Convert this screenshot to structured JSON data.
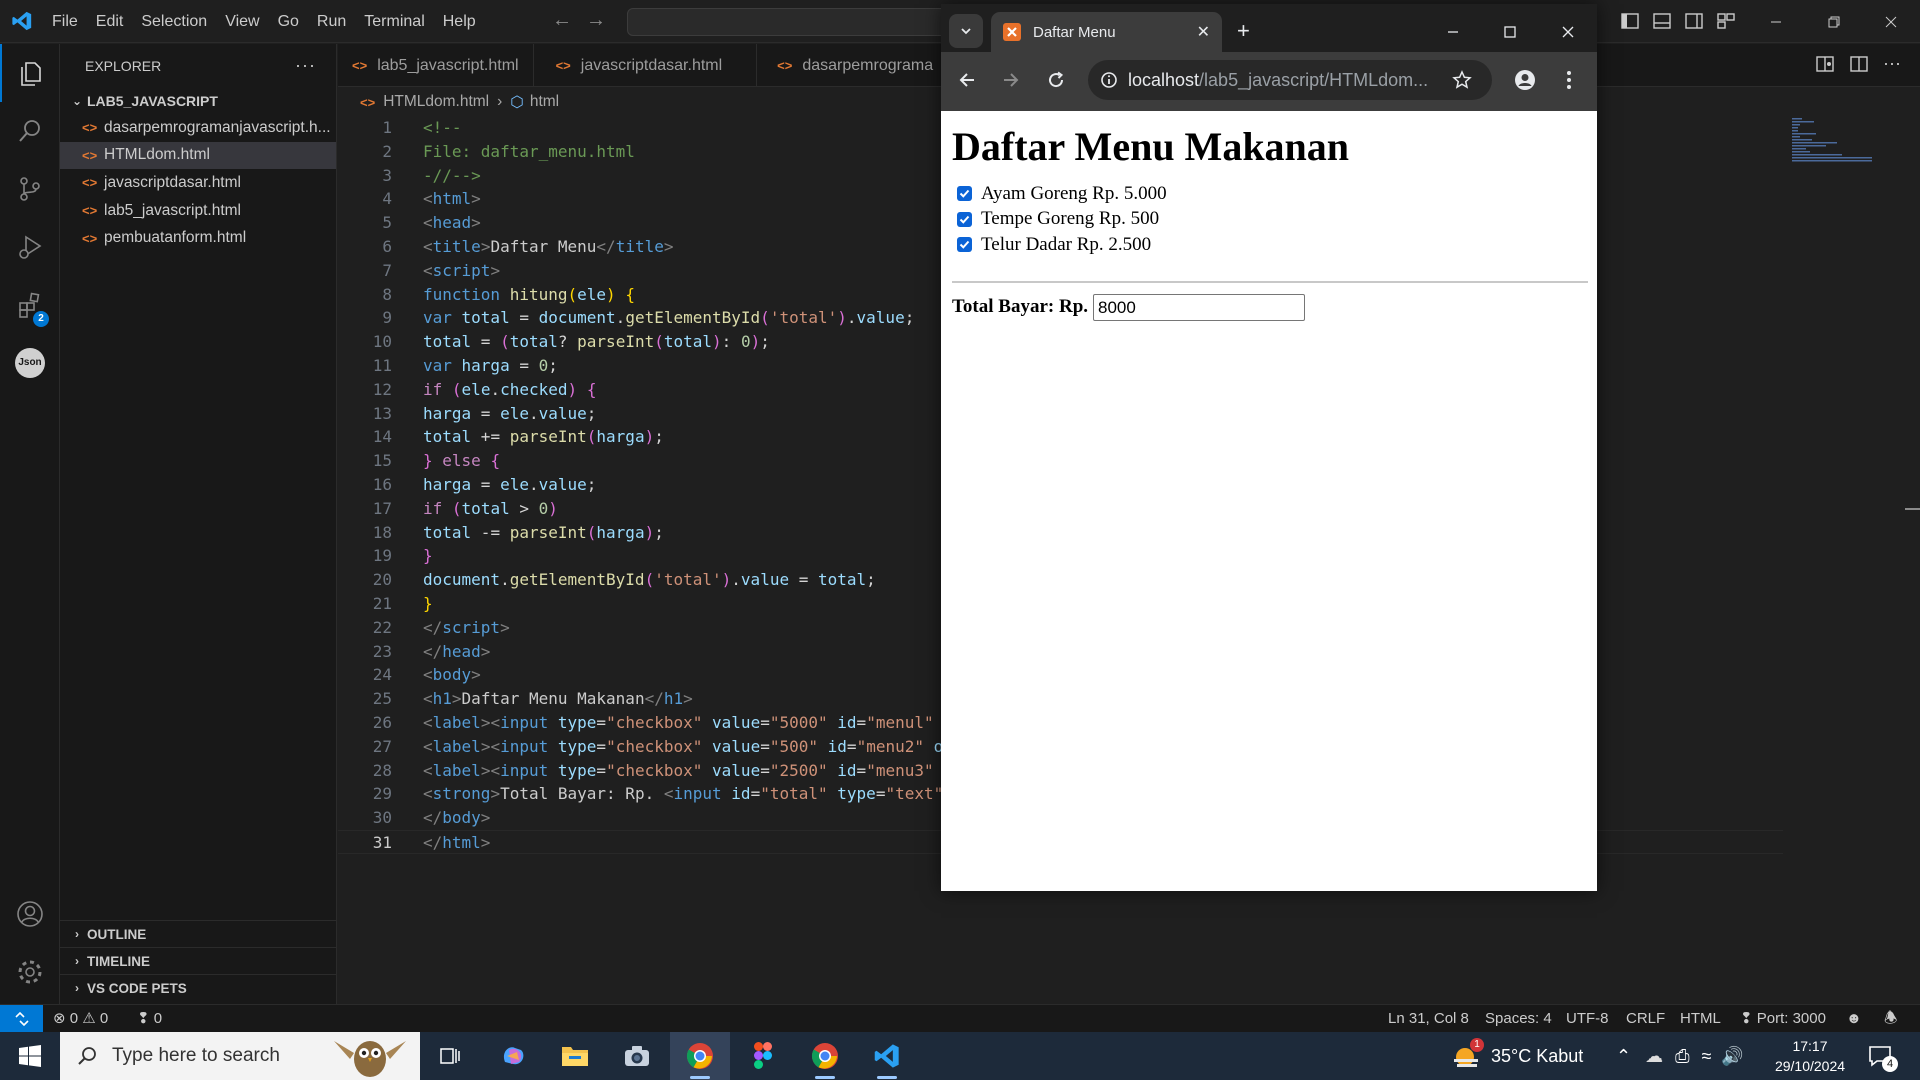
{
  "vscode": {
    "menu": [
      "File",
      "Edit",
      "Selection",
      "View",
      "Go",
      "Run",
      "Terminal",
      "Help"
    ],
    "explorer_title": "EXPLORER",
    "folder_name": "LAB5_JAVASCRIPT",
    "files": [
      {
        "name": "dasarpemrogramanjavascript.h...",
        "selected": false
      },
      {
        "name": "HTMLdom.html",
        "selected": true
      },
      {
        "name": "javascriptdasar.html",
        "selected": false
      },
      {
        "name": "lab5_javascript.html",
        "selected": false
      },
      {
        "name": "pembuatanform.html",
        "selected": false
      }
    ],
    "sections": [
      "OUTLINE",
      "TIMELINE",
      "VS CODE PETS"
    ],
    "extensions_badge": "2",
    "json_icon_label": "Json",
    "tabs": [
      "lab5_javascript.html",
      "javascriptdasar.html",
      "dasarpemrograma"
    ],
    "breadcrumb": {
      "file": "HTMLdom.html",
      "symbol": "html"
    },
    "current_line": 31,
    "code_lines": [
      [
        [
          "c-com",
          "<!--"
        ]
      ],
      [
        [
          "c-com",
          "File: daftar_menu.html"
        ]
      ],
      [
        [
          "c-com",
          "-//-->"
        ]
      ],
      [
        [
          "c-bra",
          "<"
        ],
        [
          "c-tag",
          "html"
        ],
        [
          "c-bra",
          ">"
        ]
      ],
      [
        [
          "c-bra",
          "<"
        ],
        [
          "c-tag",
          "head"
        ],
        [
          "c-bra",
          ">"
        ]
      ],
      [
        [
          "c-bra",
          "<"
        ],
        [
          "c-tag",
          "title"
        ],
        [
          "c-bra",
          ">"
        ],
        [
          "c-txt",
          "Daftar Menu"
        ],
        [
          "c-bra",
          "</"
        ],
        [
          "c-tag",
          "title"
        ],
        [
          "c-bra",
          ">"
        ]
      ],
      [
        [
          "c-bra",
          "<"
        ],
        [
          "c-tag",
          "script"
        ],
        [
          "c-bra",
          ">"
        ]
      ],
      [
        [
          "c-kw",
          "function "
        ],
        [
          "c-fn",
          "hitung"
        ],
        [
          "c-p1",
          "("
        ],
        [
          "c-var",
          "ele"
        ],
        [
          "c-p1",
          ")"
        ],
        [
          "c-pun",
          " "
        ],
        [
          "c-p1",
          "{"
        ]
      ],
      [
        [
          "c-kw",
          "var "
        ],
        [
          "c-var",
          "total"
        ],
        [
          "c-pun",
          " = "
        ],
        [
          "c-var",
          "document"
        ],
        [
          "c-pun",
          "."
        ],
        [
          "c-fn",
          "getElementById"
        ],
        [
          "c-p2",
          "("
        ],
        [
          "c-str",
          "'total'"
        ],
        [
          "c-p2",
          ")"
        ],
        [
          "c-pun",
          "."
        ],
        [
          "c-var",
          "value"
        ],
        [
          "c-pun",
          ";"
        ]
      ],
      [
        [
          "c-var",
          "total"
        ],
        [
          "c-pun",
          " = "
        ],
        [
          "c-p2",
          "("
        ],
        [
          "c-var",
          "total"
        ],
        [
          "c-pun",
          "? "
        ],
        [
          "c-fn",
          "parseInt"
        ],
        [
          "c-p2",
          "("
        ],
        [
          "c-var",
          "total"
        ],
        [
          "c-p2",
          ")"
        ],
        [
          "c-pun",
          ": "
        ],
        [
          "c-num",
          "0"
        ],
        [
          "c-p2",
          ")"
        ],
        [
          "c-pun",
          ";"
        ]
      ],
      [
        [
          "c-kw",
          "var "
        ],
        [
          "c-var",
          "harga"
        ],
        [
          "c-pun",
          " = "
        ],
        [
          "c-num",
          "0"
        ],
        [
          "c-pun",
          ";"
        ]
      ],
      [
        [
          "c-ctl",
          "if "
        ],
        [
          "c-p2",
          "("
        ],
        [
          "c-var",
          "ele"
        ],
        [
          "c-pun",
          "."
        ],
        [
          "c-var",
          "checked"
        ],
        [
          "c-p2",
          ")"
        ],
        [
          "c-pun",
          " "
        ],
        [
          "c-p2",
          "{"
        ]
      ],
      [
        [
          "c-var",
          "harga"
        ],
        [
          "c-pun",
          " = "
        ],
        [
          "c-var",
          "ele"
        ],
        [
          "c-pun",
          "."
        ],
        [
          "c-var",
          "value"
        ],
        [
          "c-pun",
          ";"
        ]
      ],
      [
        [
          "c-var",
          "total"
        ],
        [
          "c-pun",
          " += "
        ],
        [
          "c-fn",
          "parseInt"
        ],
        [
          "c-p2",
          "("
        ],
        [
          "c-var",
          "harga"
        ],
        [
          "c-p2",
          ")"
        ],
        [
          "c-pun",
          ";"
        ]
      ],
      [
        [
          "c-p2",
          "}"
        ],
        [
          "c-pun",
          " "
        ],
        [
          "c-ctl",
          "else"
        ],
        [
          "c-pun",
          " "
        ],
        [
          "c-p2",
          "{"
        ]
      ],
      [
        [
          "c-var",
          "harga"
        ],
        [
          "c-pun",
          " = "
        ],
        [
          "c-var",
          "ele"
        ],
        [
          "c-pun",
          "."
        ],
        [
          "c-var",
          "value"
        ],
        [
          "c-pun",
          ";"
        ]
      ],
      [
        [
          "c-ctl",
          "if "
        ],
        [
          "c-p2",
          "("
        ],
        [
          "c-var",
          "total"
        ],
        [
          "c-pun",
          " > "
        ],
        [
          "c-num",
          "0"
        ],
        [
          "c-p2",
          ")"
        ]
      ],
      [
        [
          "c-var",
          "total"
        ],
        [
          "c-pun",
          " -= "
        ],
        [
          "c-fn",
          "parseInt"
        ],
        [
          "c-p2",
          "("
        ],
        [
          "c-var",
          "harga"
        ],
        [
          "c-p2",
          ")"
        ],
        [
          "c-pun",
          ";"
        ]
      ],
      [
        [
          "c-p2",
          "}"
        ]
      ],
      [
        [
          "c-var",
          "document"
        ],
        [
          "c-pun",
          "."
        ],
        [
          "c-fn",
          "getElementById"
        ],
        [
          "c-p2",
          "("
        ],
        [
          "c-str",
          "'total'"
        ],
        [
          "c-p2",
          ")"
        ],
        [
          "c-pun",
          "."
        ],
        [
          "c-var",
          "value"
        ],
        [
          "c-pun",
          " = "
        ],
        [
          "c-var",
          "total"
        ],
        [
          "c-pun",
          ";"
        ]
      ],
      [
        [
          "c-p1",
          "}"
        ]
      ],
      [
        [
          "c-bra",
          "</"
        ],
        [
          "c-tag",
          "script"
        ],
        [
          "c-bra",
          ">"
        ]
      ],
      [
        [
          "c-bra",
          "</"
        ],
        [
          "c-tag",
          "head"
        ],
        [
          "c-bra",
          ">"
        ]
      ],
      [
        [
          "c-bra",
          "<"
        ],
        [
          "c-tag",
          "body"
        ],
        [
          "c-bra",
          ">"
        ]
      ],
      [
        [
          "c-bra",
          "<"
        ],
        [
          "c-tag",
          "h1"
        ],
        [
          "c-bra",
          ">"
        ],
        [
          "c-txt",
          "Daftar Menu Makanan"
        ],
        [
          "c-bra",
          "</"
        ],
        [
          "c-tag",
          "h1"
        ],
        [
          "c-bra",
          ">"
        ]
      ],
      [
        [
          "c-bra",
          "<"
        ],
        [
          "c-tag",
          "label"
        ],
        [
          "c-bra",
          "><"
        ],
        [
          "c-tag",
          "input"
        ],
        [
          "c-pun",
          " "
        ],
        [
          "c-var",
          "type"
        ],
        [
          "c-pun",
          "="
        ],
        [
          "c-str",
          "\"checkbox\""
        ],
        [
          "c-pun",
          " "
        ],
        [
          "c-var",
          "value"
        ],
        [
          "c-pun",
          "="
        ],
        [
          "c-str",
          "\"5000\""
        ],
        [
          "c-pun",
          " "
        ],
        [
          "c-var",
          "id"
        ],
        [
          "c-pun",
          "="
        ],
        [
          "c-str",
          "\"menul\""
        ]
      ],
      [
        [
          "c-bra",
          "<"
        ],
        [
          "c-tag",
          "label"
        ],
        [
          "c-bra",
          "><"
        ],
        [
          "c-tag",
          "input"
        ],
        [
          "c-pun",
          " "
        ],
        [
          "c-var",
          "type"
        ],
        [
          "c-pun",
          "="
        ],
        [
          "c-str",
          "\"checkbox\""
        ],
        [
          "c-pun",
          " "
        ],
        [
          "c-var",
          "value"
        ],
        [
          "c-pun",
          "="
        ],
        [
          "c-str",
          "\"500\""
        ],
        [
          "c-pun",
          " "
        ],
        [
          "c-var",
          "id"
        ],
        [
          "c-pun",
          "="
        ],
        [
          "c-str",
          "\"menu2\""
        ],
        [
          "c-pun",
          " "
        ],
        [
          "c-var",
          "o"
        ]
      ],
      [
        [
          "c-bra",
          "<"
        ],
        [
          "c-tag",
          "label"
        ],
        [
          "c-bra",
          "><"
        ],
        [
          "c-tag",
          "input"
        ],
        [
          "c-pun",
          " "
        ],
        [
          "c-var",
          "type"
        ],
        [
          "c-pun",
          "="
        ],
        [
          "c-str",
          "\"checkbox\""
        ],
        [
          "c-pun",
          " "
        ],
        [
          "c-var",
          "value"
        ],
        [
          "c-pun",
          "="
        ],
        [
          "c-str",
          "\"2500\""
        ],
        [
          "c-pun",
          " "
        ],
        [
          "c-var",
          "id"
        ],
        [
          "c-pun",
          "="
        ],
        [
          "c-str",
          "\"menu3\""
        ]
      ],
      [
        [
          "c-bra",
          "<"
        ],
        [
          "c-tag",
          "strong"
        ],
        [
          "c-bra",
          ">"
        ],
        [
          "c-txt",
          "Total Bayar: Rp. "
        ],
        [
          "c-bra",
          "<"
        ],
        [
          "c-tag",
          "input"
        ],
        [
          "c-pun",
          " "
        ],
        [
          "c-var",
          "id"
        ],
        [
          "c-pun",
          "="
        ],
        [
          "c-str",
          "\"total\""
        ],
        [
          "c-pun",
          " "
        ],
        [
          "c-var",
          "type"
        ],
        [
          "c-pun",
          "="
        ],
        [
          "c-str",
          "\"text\""
        ]
      ],
      [
        [
          "c-bra",
          "</"
        ],
        [
          "c-tag",
          "body"
        ],
        [
          "c-bra",
          ">"
        ]
      ],
      [
        [
          "c-bra",
          "</"
        ],
        [
          "c-tag",
          "html"
        ],
        [
          "c-bra",
          ">"
        ]
      ]
    ],
    "status": {
      "errors": "0",
      "warnings": "0",
      "ports": "0",
      "position": "Ln 31, Col 8",
      "spaces": "Spaces: 4",
      "encoding": "UTF-8",
      "eol": "CRLF",
      "language": "HTML",
      "port": "Port: 3000"
    }
  },
  "chrome": {
    "tab_title": "Daftar Menu",
    "url_host": "localhost",
    "url_path": "/lab5_javascript/HTMLdom....",
    "page": {
      "heading": "Daftar Menu Makanan",
      "items": [
        {
          "label": "Ayam Goreng Rp. 5.000",
          "checked": true
        },
        {
          "label": "Tempe Goreng Rp. 500",
          "checked": true
        },
        {
          "label": "Telur Dadar Rp. 2.500",
          "checked": true
        }
      ],
      "total_label": "Total Bayar: Rp.",
      "total_value": "8000"
    }
  },
  "taskbar": {
    "search_placeholder": "Type here to search",
    "weather": "35°C  Kabut",
    "weather_badge": "1",
    "time": "17:17",
    "date": "29/10/2024",
    "notification_count": "4"
  },
  "colors": {
    "accent": "#0078d4",
    "editor_bg": "#1f1f1f",
    "taskbar_bg": "#1d2a3a",
    "chrome_favicon": "#e8712a"
  }
}
